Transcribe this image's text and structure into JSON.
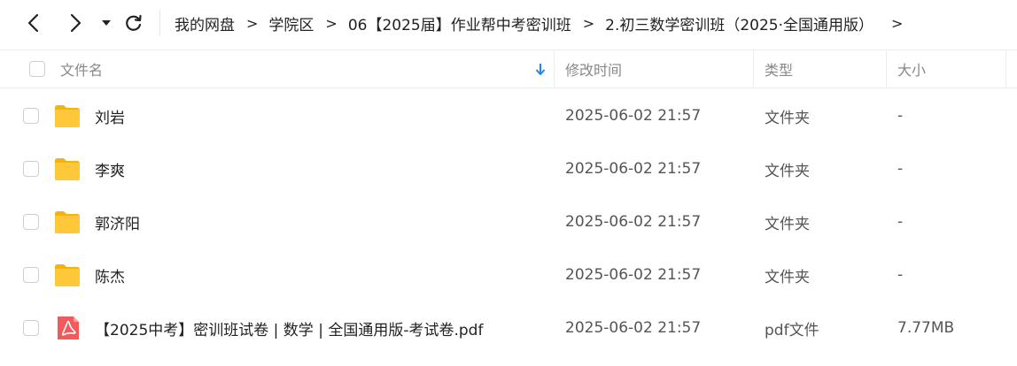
{
  "toolbar": {
    "breadcrumb": [
      "我的网盘",
      "学院区",
      "06【2025届】作业帮中考密训班",
      "2.初三数学密训班（2025·全国通用版）"
    ],
    "separator": ">"
  },
  "header": {
    "name": "文件名",
    "modified": "修改时间",
    "type": "类型",
    "size": "大小"
  },
  "rows": [
    {
      "name": "刘岩",
      "date": "2025-06-02 21:57",
      "type": "文件夹",
      "size": "-",
      "icon": "folder-icon"
    },
    {
      "name": "李爽",
      "date": "2025-06-02 21:57",
      "type": "文件夹",
      "size": "-",
      "icon": "folder-icon"
    },
    {
      "name": "郭济阳",
      "date": "2025-06-02 21:57",
      "type": "文件夹",
      "size": "-",
      "icon": "folder-icon"
    },
    {
      "name": "陈杰",
      "date": "2025-06-02 21:57",
      "type": "文件夹",
      "size": "-",
      "icon": "folder-icon"
    },
    {
      "name": "【2025中考】密训班试卷 | 数学 | 全国通用版-考试卷.pdf",
      "date": "2025-06-02 21:57",
      "type": "pdf文件",
      "size": "7.77MB",
      "icon": "pdf-icon"
    }
  ],
  "colors": {
    "folder": "#ffc52e",
    "pdf": "#f25b5b",
    "sort_arrow": "#1e88e5"
  }
}
